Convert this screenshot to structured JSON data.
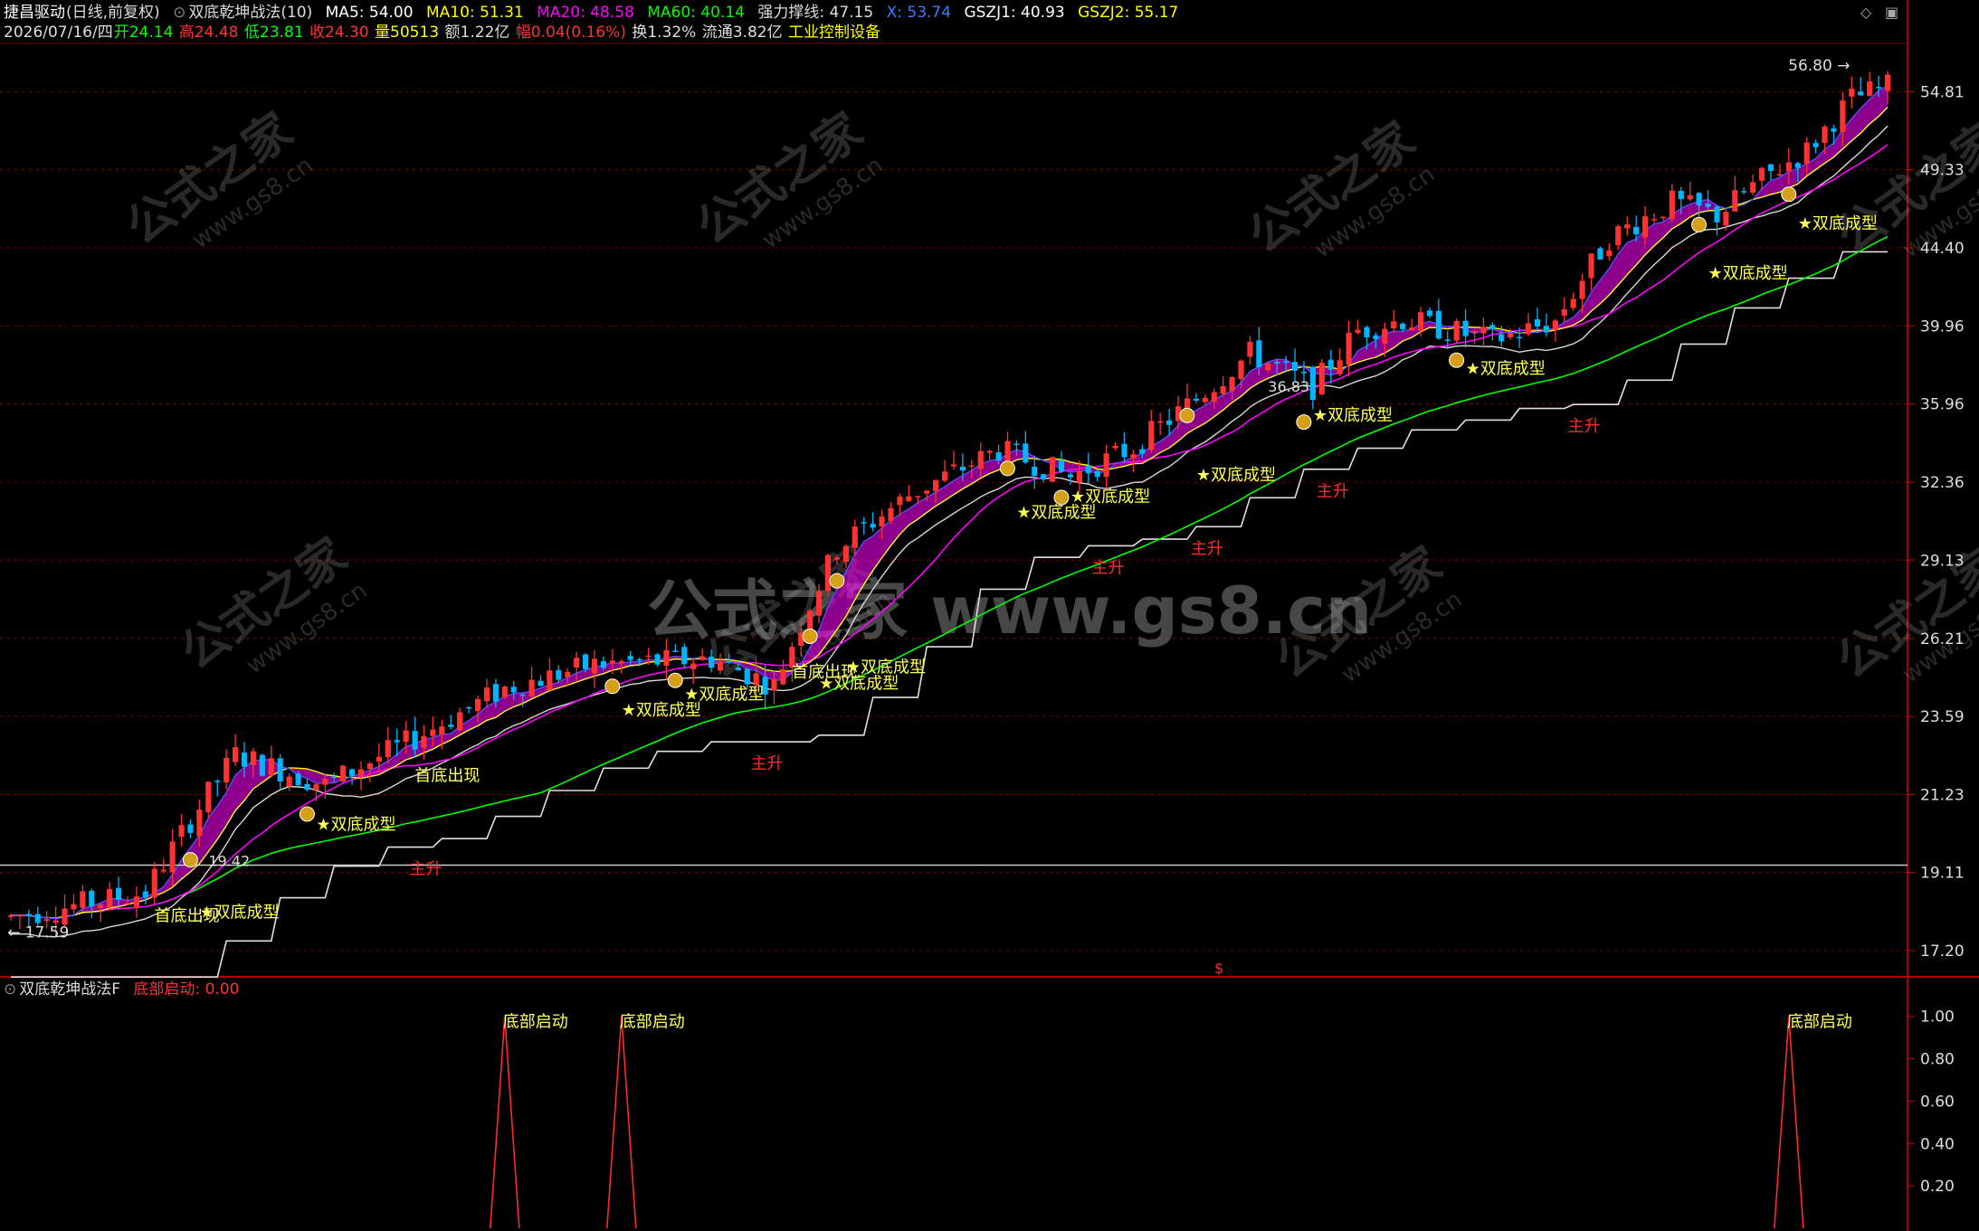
{
  "header": {
    "stock_name": "捷昌驱动",
    "period": "(日线,前复权)",
    "indicator": "双底乾坤战法(10)",
    "ma5": "MA5: 54.00",
    "ma10": "MA10: 51.31",
    "ma20": "MA20: 48.58",
    "ma60": "MA60: 40.14",
    "qlcx": "强力撑线: 47.15",
    "x": "X: 53.74",
    "gszj1": "GSZJ1: 40.93",
    "gszj2": "GSZJ2: 55.17",
    "date": "2026/07/16/四",
    "open": "开24.14",
    "high": "高24.48",
    "low": "低23.81",
    "close": "收24.30",
    "volume": "量50513",
    "amount": "额1.22亿",
    "change": "幅0.04(0.16%)",
    "turnover": "换1.32%",
    "float": "流通3.82亿",
    "industry": "工业控制设备"
  },
  "sub_header": {
    "indicator": "双底乾坤战法F",
    "value": "底部启动: 0.00"
  },
  "watermark": {
    "main": "公式之家 www.gs8.cn",
    "small_cn": "公式之家",
    "small_url": "www.gs8.cn"
  },
  "colors": {
    "up": "#ff3232",
    "down": "#00b4ff",
    "ma5": "#ffffff",
    "ma10": "#ffff00",
    "ma20": "#ff00ff",
    "ma60": "#00ff00",
    "grid": "#7a0000",
    "signal": "#ffff55"
  },
  "chart_data": [
    {
      "type": "candlestick",
      "yaxis_ticks": [
        17.2,
        19.11,
        21.23,
        23.59,
        26.21,
        29.13,
        32.36,
        35.96,
        39.96,
        44.4,
        49.33,
        54.81
      ],
      "ylim": [
        16.6,
        58.5
      ],
      "scale": "log",
      "annotations": {
        "high_mark": "56.80",
        "low_mark": "17.59",
        "mid_label_1": "19.42",
        "mid_label_2": "36.83",
        "reference_line": 19.3,
        "signal_text": "★双底成型",
        "first_bottom": "首底出现",
        "main_rise": "主升",
        "bottom_marker": "$"
      },
      "signals": [
        {
          "x": 21,
          "text": "★双底成型"
        },
        {
          "x": 34,
          "text": "★双底成型"
        },
        {
          "x": 68,
          "text": "★双底成型"
        },
        {
          "x": 75,
          "text": "★双底成型"
        },
        {
          "x": 90,
          "text": "★双底成型"
        },
        {
          "x": 93,
          "text": "★双底成型"
        },
        {
          "x": 112,
          "text": "★双底成型"
        },
        {
          "x": 118,
          "text": "★双底成型"
        },
        {
          "x": 132,
          "text": "★双底成型"
        },
        {
          "x": 145,
          "text": "★双底成型"
        },
        {
          "x": 162,
          "text": "★双底成型"
        },
        {
          "x": 189,
          "text": "★双底成型"
        },
        {
          "x": 199,
          "text": "★双底成型"
        }
      ],
      "first_bottom_x": [
        18,
        47,
        89
      ],
      "main_rise_x": [
        46,
        84,
        122,
        133,
        147,
        175
      ]
    },
    {
      "type": "line",
      "series": [
        {
          "name": "底部启动",
          "peaks": [
            {
              "x": 55,
              "label": "底部启动"
            },
            {
              "x": 68,
              "label": "底部启动"
            },
            {
              "x": 198,
              "label": "底部启动"
            }
          ]
        }
      ],
      "yaxis_ticks": [
        0.2,
        0.4,
        0.6,
        0.8,
        1.0
      ],
      "ylim": [
        0,
        1.05
      ]
    }
  ]
}
